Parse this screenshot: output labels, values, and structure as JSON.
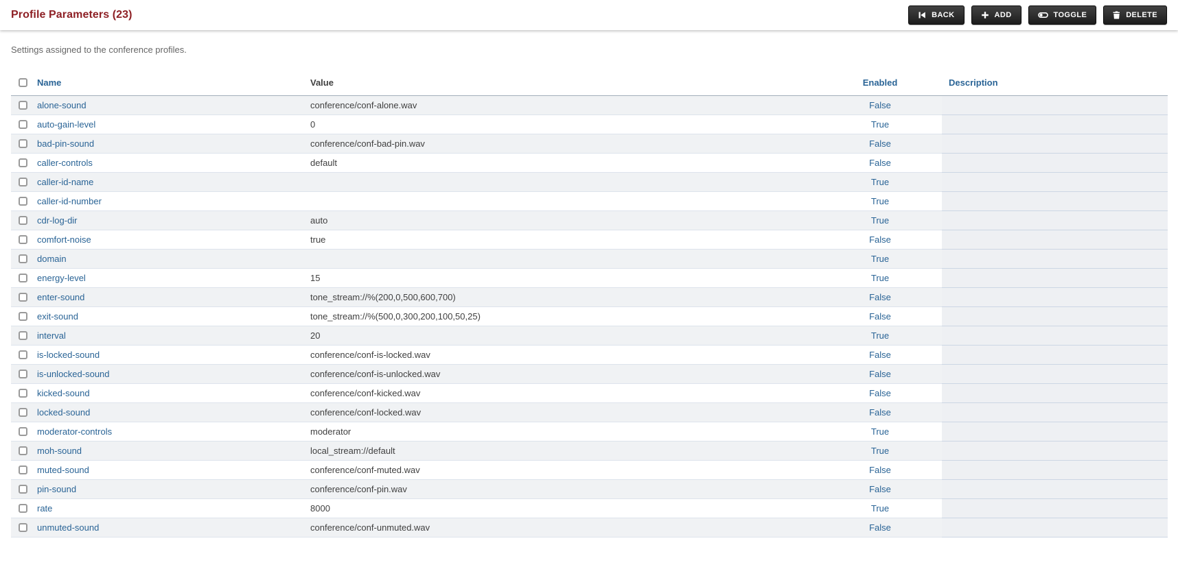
{
  "header": {
    "title": "Profile Parameters (23)",
    "buttons": [
      {
        "id": "back",
        "label": "BACK",
        "icon": "skip-back-icon"
      },
      {
        "id": "add",
        "label": "ADD",
        "icon": "plus-icon"
      },
      {
        "id": "toggle",
        "label": "TOGGLE",
        "icon": "toggle-icon"
      },
      {
        "id": "delete",
        "label": "DELETE",
        "icon": "trash-icon"
      }
    ]
  },
  "subtitle": "Settings assigned to the conference profiles.",
  "table": {
    "columns": [
      "Name",
      "Value",
      "Enabled",
      "Description"
    ],
    "rows": [
      {
        "name": "alone-sound",
        "value": "conference/conf-alone.wav",
        "enabled": "False",
        "description": ""
      },
      {
        "name": "auto-gain-level",
        "value": "0",
        "enabled": "True",
        "description": ""
      },
      {
        "name": "bad-pin-sound",
        "value": "conference/conf-bad-pin.wav",
        "enabled": "False",
        "description": ""
      },
      {
        "name": "caller-controls",
        "value": "default",
        "enabled": "False",
        "description": ""
      },
      {
        "name": "caller-id-name",
        "value": "",
        "enabled": "True",
        "description": ""
      },
      {
        "name": "caller-id-number",
        "value": "",
        "enabled": "True",
        "description": ""
      },
      {
        "name": "cdr-log-dir",
        "value": "auto",
        "enabled": "True",
        "description": ""
      },
      {
        "name": "comfort-noise",
        "value": "true",
        "enabled": "False",
        "description": ""
      },
      {
        "name": "domain",
        "value": "",
        "enabled": "True",
        "description": ""
      },
      {
        "name": "energy-level",
        "value": "15",
        "enabled": "True",
        "description": ""
      },
      {
        "name": "enter-sound",
        "value": "tone_stream://%(200,0,500,600,700)",
        "enabled": "False",
        "description": ""
      },
      {
        "name": "exit-sound",
        "value": "tone_stream://%(500,0,300,200,100,50,25)",
        "enabled": "False",
        "description": ""
      },
      {
        "name": "interval",
        "value": "20",
        "enabled": "True",
        "description": ""
      },
      {
        "name": "is-locked-sound",
        "value": "conference/conf-is-locked.wav",
        "enabled": "False",
        "description": ""
      },
      {
        "name": "is-unlocked-sound",
        "value": "conference/conf-is-unlocked.wav",
        "enabled": "False",
        "description": ""
      },
      {
        "name": "kicked-sound",
        "value": "conference/conf-kicked.wav",
        "enabled": "False",
        "description": ""
      },
      {
        "name": "locked-sound",
        "value": "conference/conf-locked.wav",
        "enabled": "False",
        "description": ""
      },
      {
        "name": "moderator-controls",
        "value": "moderator",
        "enabled": "True",
        "description": ""
      },
      {
        "name": "moh-sound",
        "value": "local_stream://default",
        "enabled": "True",
        "description": ""
      },
      {
        "name": "muted-sound",
        "value": "conference/conf-muted.wav",
        "enabled": "False",
        "description": ""
      },
      {
        "name": "pin-sound",
        "value": "conference/conf-pin.wav",
        "enabled": "False",
        "description": ""
      },
      {
        "name": "rate",
        "value": "8000",
        "enabled": "True",
        "description": ""
      },
      {
        "name": "unmuted-sound",
        "value": "conference/conf-unmuted.wav",
        "enabled": "False",
        "description": ""
      }
    ]
  },
  "colors": {
    "title_red": "#8e2025",
    "link_blue": "#2a6496",
    "button_bg": "#262626",
    "stripe_gray": "#f0f2f4",
    "description_cell_gray": "#eef0f3"
  }
}
